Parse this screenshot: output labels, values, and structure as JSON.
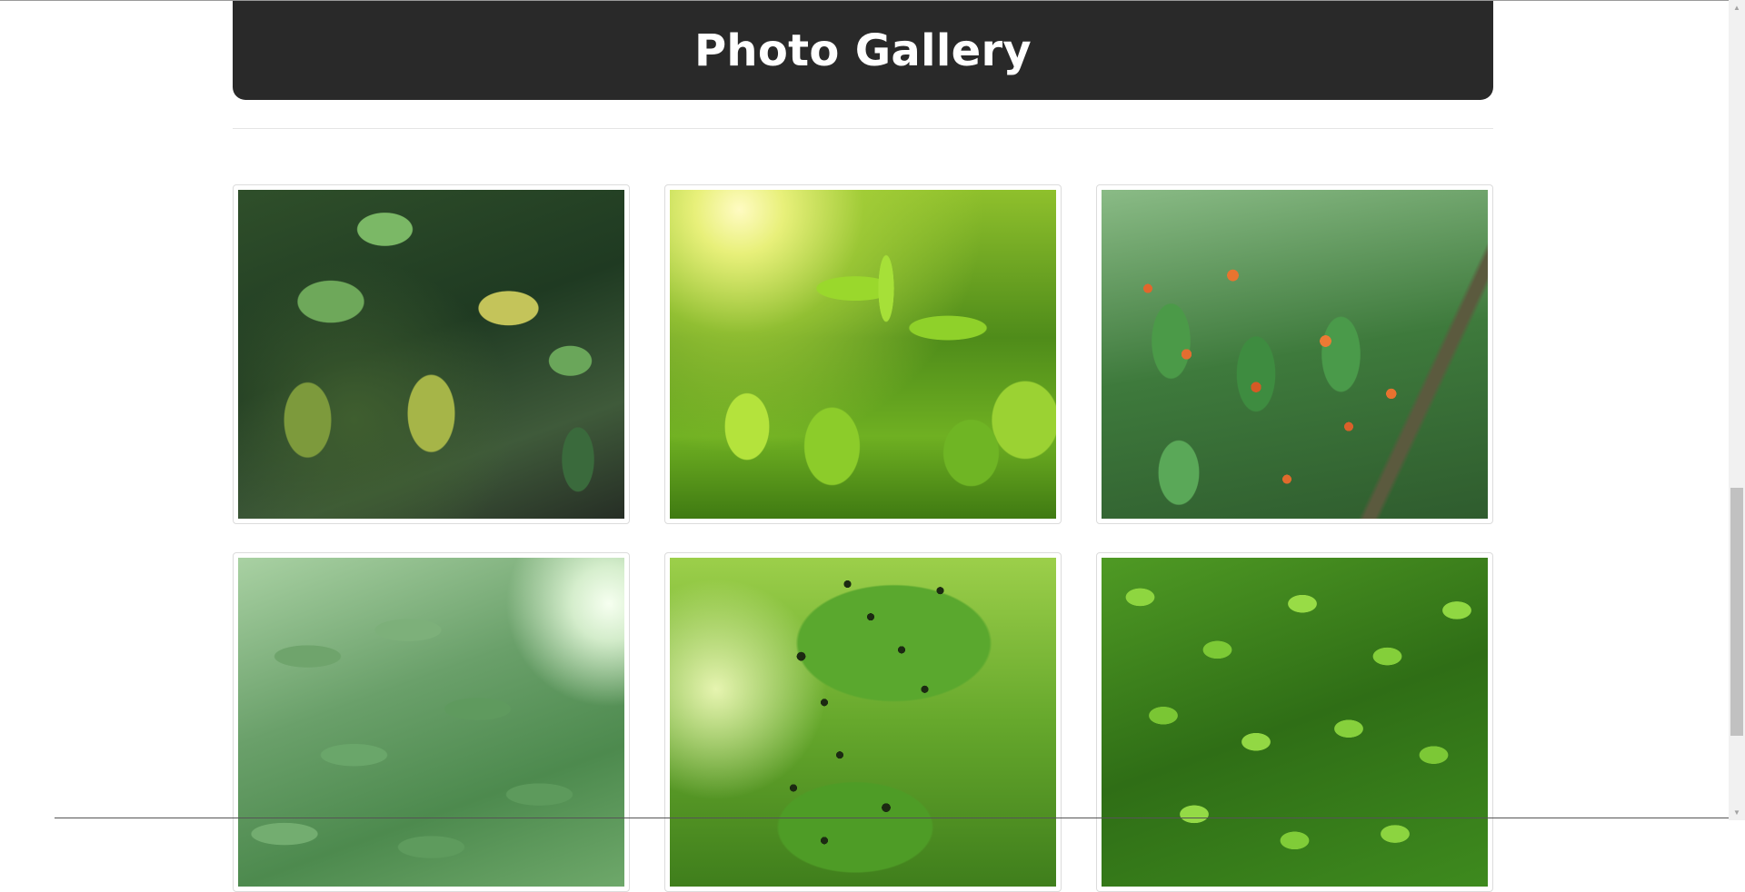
{
  "header": {
    "title": "Photo Gallery"
  },
  "gallery": {
    "photos": [
      {
        "subject": "rose leaves with dark spots"
      },
      {
        "subject": "tea shoots in sunlight"
      },
      {
        "subject": "leaves with orange rust spots"
      },
      {
        "subject": "cassava leaves canopy"
      },
      {
        "subject": "leaves with black spot holes"
      },
      {
        "subject": "dense green leaves"
      }
    ]
  },
  "scrollbar": {
    "position": 0.73
  }
}
